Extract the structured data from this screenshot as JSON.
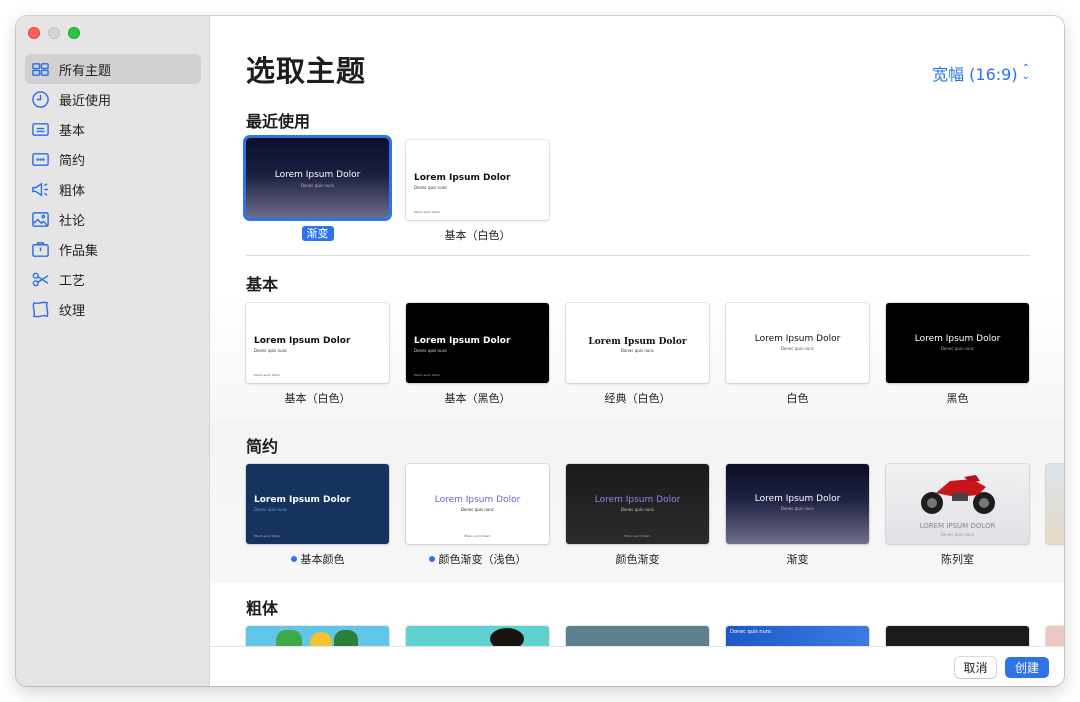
{
  "sidebar": {
    "items": [
      {
        "label": "所有主题",
        "icon": "grid-icon"
      },
      {
        "label": "最近使用",
        "icon": "clock-icon"
      },
      {
        "label": "基本",
        "icon": "rectangle-icon"
      },
      {
        "label": "简约",
        "icon": "dots-icon"
      },
      {
        "label": "粗体",
        "icon": "megaphone-icon"
      },
      {
        "label": "社论",
        "icon": "photo-icon"
      },
      {
        "label": "作品集",
        "icon": "briefcase-icon"
      },
      {
        "label": "工艺",
        "icon": "scissors-icon"
      },
      {
        "label": "纹理",
        "icon": "texture-icon"
      }
    ],
    "active_index": 0
  },
  "header": {
    "title": "选取主题",
    "ratio": "宽幅 (16:9)"
  },
  "sections": {
    "recent": {
      "title": "最近使用",
      "cards": [
        {
          "label": "渐变",
          "thumb_title": "Lorem Ipsum Dolor",
          "thumb_sub": "Donec quis nunc",
          "selected": true
        },
        {
          "label": "基本（白色）",
          "thumb_title": "Lorem Ipsum Dolor",
          "thumb_sub": "Donec quis nunc",
          "thumb_foot": "Etiam enim Diam"
        }
      ]
    },
    "basic": {
      "title": "基本",
      "cards": [
        {
          "label": "基本（白色）",
          "thumb_title": "Lorem Ipsum Dolor",
          "thumb_sub": "Donec quis nunc",
          "thumb_foot": "Etiam enim Diam"
        },
        {
          "label": "基本（黑色）",
          "thumb_title": "Lorem Ipsum Dolor",
          "thumb_sub": "Donec quis nunc",
          "thumb_foot": "Etiam enim Diam"
        },
        {
          "label": "经典（白色）",
          "thumb_title": "Lorem Ipsum Dolor",
          "thumb_sub": "Donec quis nunc"
        },
        {
          "label": "白色",
          "thumb_title": "Lorem Ipsum Dolor",
          "thumb_sub": "Donec quis nunc"
        },
        {
          "label": "黑色",
          "thumb_title": "Lorem Ipsum Dolor",
          "thumb_sub": "Donec quis nunc"
        }
      ]
    },
    "minimal": {
      "title": "简约",
      "cards": [
        {
          "label": "基本颜色",
          "dot": true,
          "thumb_title": "Lorem Ipsum Dolor",
          "thumb_sub": "Donec quis nunc",
          "thumb_foot": "Etiam enim Diam"
        },
        {
          "label": "颜色渐变（浅色）",
          "dot": true,
          "thumb_title": "Lorem Ipsum Dolor",
          "thumb_sub": "Donec quis nunc",
          "thumb_foot": "Etiam enim Diam"
        },
        {
          "label": "颜色渐变",
          "thumb_title": "Lorem Ipsum Dolor",
          "thumb_sub": "Donec quis nunc",
          "thumb_foot": "Etiam enim Diam"
        },
        {
          "label": "渐变",
          "thumb_title": "Lorem Ipsum Dolor",
          "thumb_sub": "Donec quis nunc"
        },
        {
          "label": "陈列室",
          "thumb_title": "LOREM IPSUM DOLOR",
          "thumb_sub": "Donec quis nunc"
        }
      ]
    },
    "bold": {
      "title": "粗体",
      "cards": [
        {
          "thumb_title": ""
        },
        {
          "thumb_title": ""
        },
        {
          "thumb_title": ""
        },
        {
          "thumb_title": "Donec quis nunc"
        },
        {
          "thumb_title": ""
        }
      ]
    }
  },
  "footer": {
    "cancel_label": "取消",
    "create_label": "创建"
  },
  "colors": {
    "accent": "#2f73e8",
    "sidebar_bg": "#e6e4e5"
  }
}
